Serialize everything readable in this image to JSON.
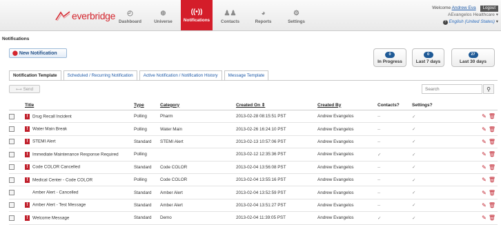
{
  "brand": {
    "logo_text": "everbridge"
  },
  "nav": [
    {
      "label": "Dashboard",
      "icon": "dashboard-icon",
      "glyph": "◴"
    },
    {
      "label": "Universe",
      "icon": "globe-icon",
      "glyph": "⊕"
    },
    {
      "label": "Notifications",
      "icon": "broadcast-icon",
      "glyph": "((•))"
    },
    {
      "label": "Contacts",
      "icon": "contacts-icon",
      "glyph": "♟♟"
    },
    {
      "label": "Reports",
      "icon": "pie-chart-icon",
      "glyph": "◕"
    },
    {
      "label": "Settings",
      "icon": "gear-icon",
      "glyph": "⚙"
    }
  ],
  "user": {
    "welcome": "Welcome",
    "name": "Andrew Eva",
    "logout": "Logout",
    "org": "AEvangelos Healthcare",
    "language": "English (United States)"
  },
  "breadcrumb": "Notifications",
  "new_button": "New Notification",
  "stats": [
    {
      "count": "0",
      "label": "In Progress"
    },
    {
      "count": "0",
      "label": "Last 7 days"
    },
    {
      "count": "27",
      "label": "Last 30 days"
    }
  ],
  "tabs": [
    "Notification Template",
    "Scheduled / Recurring Notification",
    "Active Notification / Notification History",
    "Message Template"
  ],
  "send_label": "Send",
  "search_placeholder": "Search",
  "columns": {
    "title": "Title",
    "type": "Type",
    "category": "Category",
    "created_on": "Created On",
    "created_by": "Created By",
    "contacts": "Contacts?",
    "settings": "Settings?"
  },
  "rows": [
    {
      "flag": true,
      "title": "Drug Recall Incident",
      "type": "Polling",
      "category": "Pharm",
      "created_on": "2013-02-28 08:15:51 PST",
      "created_by": "Andrew Evangelos",
      "contacts": "--",
      "settings": "✓"
    },
    {
      "flag": true,
      "title": "Water Main Break",
      "type": "Polling",
      "category": "Water Main",
      "created_on": "2013-02-26 16:24:10 PST",
      "created_by": "Andrew Evangelos",
      "contacts": "--",
      "settings": "✓"
    },
    {
      "flag": true,
      "title": "STEMI Alert",
      "type": "Standard",
      "category": "STEMI Alert",
      "created_on": "2013-02-13 10:57:06 PST",
      "created_by": "Andrew Evangelos",
      "contacts": "--",
      "settings": "✓"
    },
    {
      "flag": true,
      "title": "Immediate Maintenance Response Required",
      "type": "Polling",
      "category": "",
      "created_on": "2013-02-12 12:35:36 PST",
      "created_by": "Andrew Evangelos",
      "contacts": "✓",
      "settings": "✓"
    },
    {
      "flag": true,
      "title": "Code COLOR Cancelled",
      "type": "Standard",
      "category": "Code COLOR",
      "created_on": "2013-02-04 13:56:08 PST",
      "created_by": "Andrew Evangelos",
      "contacts": "--",
      "settings": "✓"
    },
    {
      "flag": true,
      "title": "Medical Center - Code COLOR",
      "type": "Polling",
      "category": "Code COLOR",
      "created_on": "2013-02-04 13:55:16 PST",
      "created_by": "Andrew Evangelos",
      "contacts": "--",
      "settings": "✓"
    },
    {
      "flag": false,
      "title": "Amber Alert - Cancelled",
      "type": "Standard",
      "category": "Amber Alert",
      "created_on": "2013-02-04 13:52:59 PST",
      "created_by": "Andrew Evangelos",
      "contacts": "--",
      "settings": "✓"
    },
    {
      "flag": true,
      "title": "Amber Alert - Test Message",
      "type": "Standard",
      "category": "Amber Alert",
      "created_on": "2013-02-04 13:51:27 PST",
      "created_by": "Andrew Evangelos",
      "contacts": "--",
      "settings": "✓"
    },
    {
      "flag": true,
      "title": "Welcome Message",
      "type": "Standard",
      "category": "Demo",
      "created_on": "2013-02-04 11:39:05 PST",
      "created_by": "Andrew Evangelos",
      "contacts": "✓",
      "settings": "✓"
    }
  ],
  "colors": {
    "brand_red": "#d41d2a",
    "link_blue": "#1e5aa8",
    "badge_blue": "#1f5a96"
  }
}
